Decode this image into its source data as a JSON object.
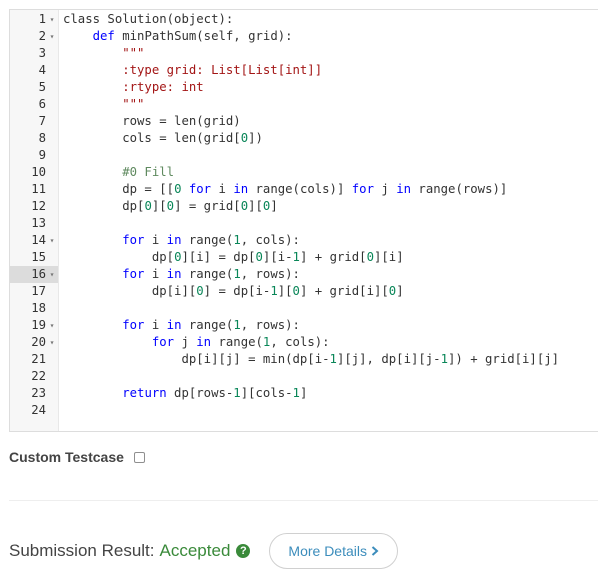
{
  "editor": {
    "active_line": 16,
    "fold_lines": [
      1,
      2,
      14,
      16,
      19,
      20
    ],
    "code_lines": [
      [
        [
          "class Solution(object):",
          ""
        ]
      ],
      [
        [
          "    ",
          ""
        ],
        [
          "def",
          "kw"
        ],
        [
          " minPathSum(self, grid):",
          ""
        ]
      ],
      [
        [
          "        \"\"\"",
          "str"
        ]
      ],
      [
        [
          "        :type grid: List[List[int]]",
          "str"
        ]
      ],
      [
        [
          "        :rtype: int",
          "str"
        ]
      ],
      [
        [
          "        \"\"\"",
          "str"
        ]
      ],
      [
        [
          "        rows = len(grid)",
          ""
        ]
      ],
      [
        [
          "        cols = len(grid[",
          ""
        ],
        [
          "0",
          "num"
        ],
        [
          "])",
          ""
        ]
      ],
      [
        [
          "",
          ""
        ]
      ],
      [
        [
          "        #0 Fill",
          "cmt"
        ]
      ],
      [
        [
          "        dp = [[",
          ""
        ],
        [
          "0",
          "num"
        ],
        [
          " ",
          ""
        ],
        [
          "for",
          "kw"
        ],
        [
          " i ",
          ""
        ],
        [
          "in",
          "kw"
        ],
        [
          " range(cols)] ",
          ""
        ],
        [
          "for",
          "kw"
        ],
        [
          " j ",
          ""
        ],
        [
          "in",
          "kw"
        ],
        [
          " range(rows)]",
          ""
        ]
      ],
      [
        [
          "        dp[",
          ""
        ],
        [
          "0",
          "num"
        ],
        [
          "][",
          ""
        ],
        [
          "0",
          "num"
        ],
        [
          "] = grid[",
          ""
        ],
        [
          "0",
          "num"
        ],
        [
          "][",
          ""
        ],
        [
          "0",
          "num"
        ],
        [
          "]",
          ""
        ]
      ],
      [
        [
          "",
          ""
        ]
      ],
      [
        [
          "        ",
          ""
        ],
        [
          "for",
          "kw"
        ],
        [
          " i ",
          ""
        ],
        [
          "in",
          "kw"
        ],
        [
          " range(",
          ""
        ],
        [
          "1",
          "num"
        ],
        [
          ", cols):",
          ""
        ]
      ],
      [
        [
          "            dp[",
          ""
        ],
        [
          "0",
          "num"
        ],
        [
          "][i] = dp[",
          ""
        ],
        [
          "0",
          "num"
        ],
        [
          "][i-",
          ""
        ],
        [
          "1",
          "num"
        ],
        [
          "] + grid[",
          ""
        ],
        [
          "0",
          "num"
        ],
        [
          "][i]",
          ""
        ]
      ],
      [
        [
          "        ",
          ""
        ],
        [
          "for",
          "kw"
        ],
        [
          " i ",
          ""
        ],
        [
          "in",
          "kw"
        ],
        [
          " range(",
          ""
        ],
        [
          "1",
          "num"
        ],
        [
          ", rows):",
          ""
        ]
      ],
      [
        [
          "            dp[i][",
          ""
        ],
        [
          "0",
          "num"
        ],
        [
          "] = dp[i-",
          ""
        ],
        [
          "1",
          "num"
        ],
        [
          "][",
          ""
        ],
        [
          "0",
          "num"
        ],
        [
          "] + grid[i][",
          ""
        ],
        [
          "0",
          "num"
        ],
        [
          "]",
          ""
        ]
      ],
      [
        [
          "",
          ""
        ]
      ],
      [
        [
          "        ",
          ""
        ],
        [
          "for",
          "kw"
        ],
        [
          " i ",
          ""
        ],
        [
          "in",
          "kw"
        ],
        [
          " range(",
          ""
        ],
        [
          "1",
          "num"
        ],
        [
          ", rows):",
          ""
        ]
      ],
      [
        [
          "            ",
          ""
        ],
        [
          "for",
          "kw"
        ],
        [
          " j ",
          ""
        ],
        [
          "in",
          "kw"
        ],
        [
          " range(",
          ""
        ],
        [
          "1",
          "num"
        ],
        [
          ", cols):",
          ""
        ]
      ],
      [
        [
          "                dp[i][j] = min(dp[i-",
          ""
        ],
        [
          "1",
          "num"
        ],
        [
          "][j], dp[i][j-",
          ""
        ],
        [
          "1",
          "num"
        ],
        [
          "]) + grid[i][j]",
          ""
        ]
      ],
      [
        [
          "",
          ""
        ]
      ],
      [
        [
          "        ",
          ""
        ],
        [
          "return",
          "kw"
        ],
        [
          " dp[rows-",
          ""
        ],
        [
          "1",
          "num"
        ],
        [
          "][cols-",
          ""
        ],
        [
          "1",
          "num"
        ],
        [
          "]",
          ""
        ]
      ],
      [
        [
          "",
          ""
        ]
      ]
    ]
  },
  "custom_testcase": {
    "label": "Custom Testcase",
    "checked": false
  },
  "submission": {
    "label": "Submission Result:",
    "status": "Accepted",
    "help_icon": "question-circle-icon",
    "details_label": "More Details",
    "status_color": "#3a8a3a",
    "link_color": "#3c8dbc"
  }
}
